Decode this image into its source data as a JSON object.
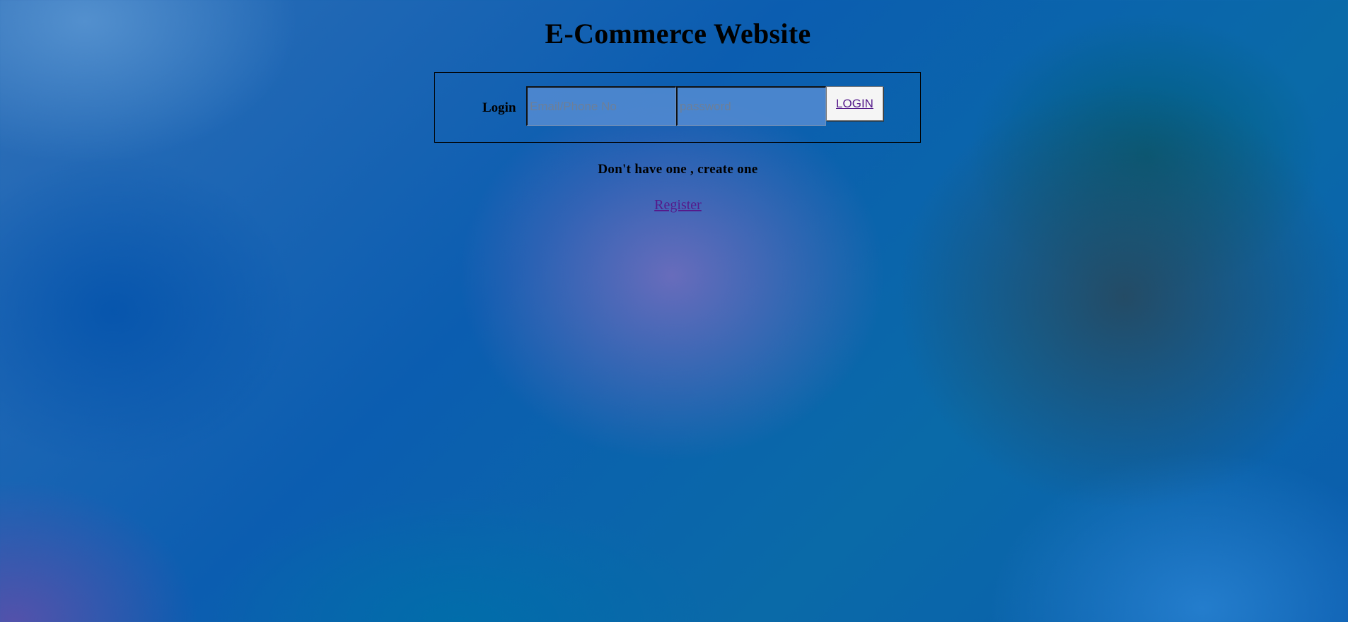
{
  "header": {
    "title": "E-Commerce Website"
  },
  "login_form": {
    "label": "Login",
    "email_placeholder": "Email/Phone No",
    "email_value": "",
    "password_placeholder": "password",
    "password_value": "",
    "submit_label": "LOGIN"
  },
  "signup": {
    "prompt": "Don't have one , create one",
    "register_link": "Register"
  },
  "colors": {
    "link": "#551a8b",
    "text": "#000000",
    "background_base": "#0b5db0"
  }
}
